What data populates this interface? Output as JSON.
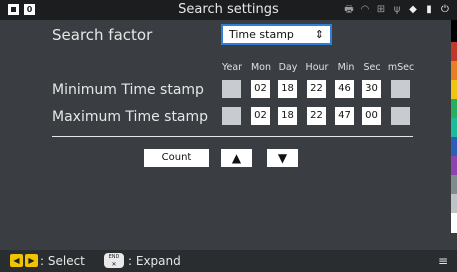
{
  "statusbar": {
    "title": "Search settings",
    "badge_number": "0",
    "icons": [
      "printer-icon",
      "wifi-icon",
      "network-icon",
      "usb-icon",
      "bluetooth-icon",
      "sd-card-icon",
      "plug-icon"
    ]
  },
  "search_factor": {
    "label": "Search factor",
    "selected": "Time stamp",
    "chevron": "⌃⌄"
  },
  "columns": [
    "Year",
    "Mon",
    "Day",
    "Hour",
    "Min",
    "Sec",
    "mSec"
  ],
  "rows": [
    {
      "label": "Minimum Time stamp",
      "values": [
        "",
        "02",
        "18",
        "22",
        "46",
        "30",
        ""
      ]
    },
    {
      "label": "Maximum Time stamp",
      "values": [
        "",
        "02",
        "18",
        "22",
        "47",
        "00",
        ""
      ]
    }
  ],
  "buttons": {
    "count": "Count",
    "up": "▲",
    "down": "▼"
  },
  "bottombar": {
    "select_label": ": Select",
    "end_key_top": "END",
    "end_key_bottom": "✕",
    "expand_label": ": Expand"
  },
  "colors": {
    "background": "#3a3e42",
    "statusbar": "#1b1d1f",
    "accent_border": "#2f7fd6",
    "arrow_keys": "#f0c400",
    "strip": [
      "#000000",
      "#c0392b",
      "#e67e22",
      "#f1c40f",
      "#27ae60",
      "#1abc9c",
      "#2e5fb8",
      "#8e44ad",
      "#7f8c8d",
      "#bdc3c7",
      "#ffffff"
    ]
  }
}
